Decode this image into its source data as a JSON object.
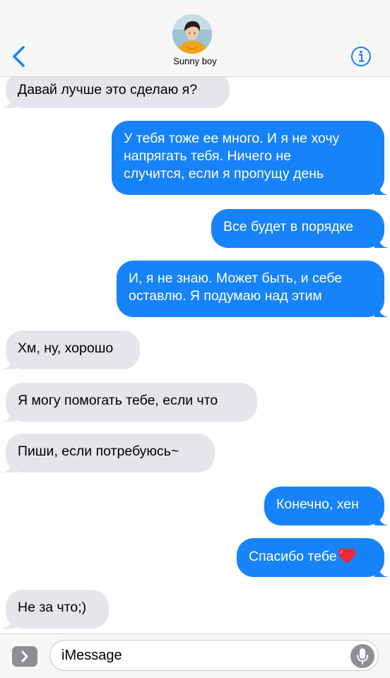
{
  "header": {
    "contact_name": "Sunny boy"
  },
  "messages": [
    {
      "direction": "in",
      "lines": [
        "Давай лучше это сделаю я?"
      ]
    },
    {
      "direction": "out",
      "lines": [
        "У тебя тоже ее много. И я не хочу",
        "напрягать тебя. Ничего не",
        "случится, если я пропущу день"
      ]
    },
    {
      "direction": "out",
      "lines": [
        "Все будет в порядке"
      ]
    },
    {
      "direction": "out",
      "lines": [
        "И, я не знаю. Может быть, и себе",
        "оставлю. Я подумаю над этим"
      ]
    },
    {
      "direction": "in",
      "lines": [
        "Хм, ну, хорошо"
      ]
    },
    {
      "direction": "in",
      "lines": [
        "Я могу помогать тебе, если что"
      ]
    },
    {
      "direction": "in",
      "lines": [
        "Пиши, если потребуюсь~"
      ]
    },
    {
      "direction": "out",
      "lines": [
        "Конечно, хен"
      ]
    },
    {
      "direction": "out",
      "lines": [
        "Спасибо тебе"
      ],
      "emoji": "red-heart"
    },
    {
      "direction": "in",
      "lines": [
        "Не за что;)"
      ]
    }
  ],
  "composer": {
    "placeholder": "iMessage"
  },
  "colors": {
    "accent": "#1683fb",
    "incoming_bubble": "#e6e5eb",
    "header_bg": "#f7f7f7"
  },
  "icons": {
    "back": "chevron-left-icon",
    "info": "info-icon",
    "apps": "chevron-right-icon",
    "mic": "microphone-icon"
  }
}
